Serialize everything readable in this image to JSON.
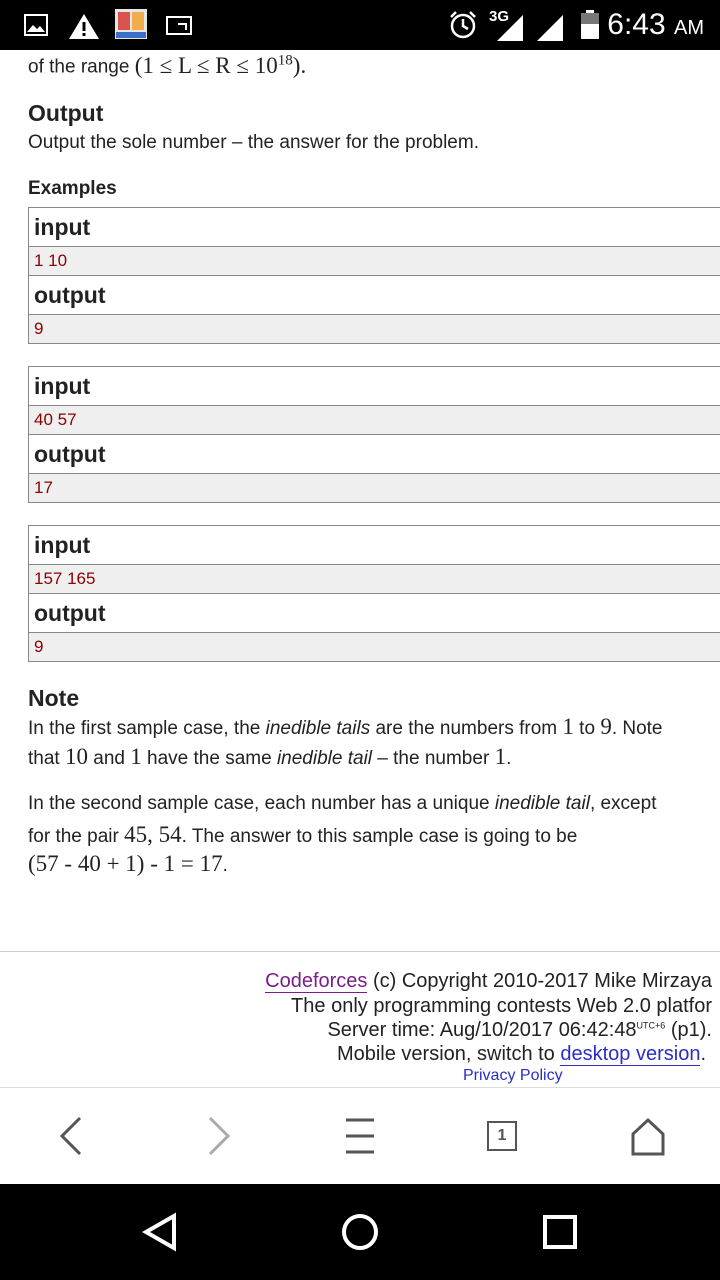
{
  "status_bar": {
    "time": "6:43",
    "ampm": "AM",
    "network": "3G",
    "icons": [
      "image-icon",
      "warning-icon",
      "app-icon",
      "cast-icon",
      "alarm-icon",
      "signal-icon",
      "signal-icon",
      "battery-icon"
    ]
  },
  "statement": {
    "range_prefix": "of the range ",
    "range_math": "(1 ≤ L ≤ R ≤ 10",
    "range_exp": "18",
    "range_suffix": ")."
  },
  "output_section": {
    "title": "Output",
    "text": "Output the sole number – the answer for the problem."
  },
  "examples": {
    "title": "Examples",
    "input_label": "input",
    "output_label": "output",
    "items": [
      {
        "input": "1 10",
        "output": "9"
      },
      {
        "input": "40 57",
        "output": "17"
      },
      {
        "input": "157 165",
        "output": "9"
      }
    ]
  },
  "note": {
    "title": "Note",
    "p1": {
      "a": "In the first sample case, the ",
      "em1": "inedible tails",
      "b": " are the numbers from ",
      "n1": "1",
      "c": " to ",
      "n2": "9",
      "d": ". Note",
      "e": "that ",
      "n3": "10",
      "f": " and ",
      "n4": "1",
      "g": " have the same ",
      "em2": "inedible tail",
      "h": " – the number ",
      "n5": "1",
      "i": "."
    },
    "p2": {
      "a": "In the second sample case, each number has a unique ",
      "em1": "inedible tail",
      "b": ", except",
      "c": "for the pair ",
      "n1": "45, 54",
      "d": ". The answer to this sample case is going to be",
      "formula": "(57 - 40 + 1) - 1 = 17",
      "e": "."
    }
  },
  "footer": {
    "codeforces_link": "Codeforces",
    "copyright": " (c) Copyright 2010-2017 Mike Mirzaya",
    "tagline": "The only programming contests Web 2.0 platfor",
    "server_time_prefix": "Server time: Aug/10/2017 06:42:48",
    "utc": "UTC+6",
    "server_time_suffix": " (p1).",
    "mobile_prefix": "Mobile version, switch to ",
    "desktop_link": "desktop version",
    "mobile_suffix": ".",
    "privacy": "Privacy Policy"
  },
  "toolbar": {
    "tab_count": "1",
    "icons": [
      "back-icon",
      "forward-icon",
      "menu-icon",
      "tabs-icon",
      "home-icon"
    ]
  },
  "navbar": {
    "icons": [
      "nav-back-icon",
      "nav-home-icon",
      "nav-recents-icon"
    ]
  },
  "colors": {
    "sample_value": "#8b0000",
    "visited_link": "#7a1e8c",
    "link": "#2a2ec6",
    "sample_bg": "#efefef"
  }
}
